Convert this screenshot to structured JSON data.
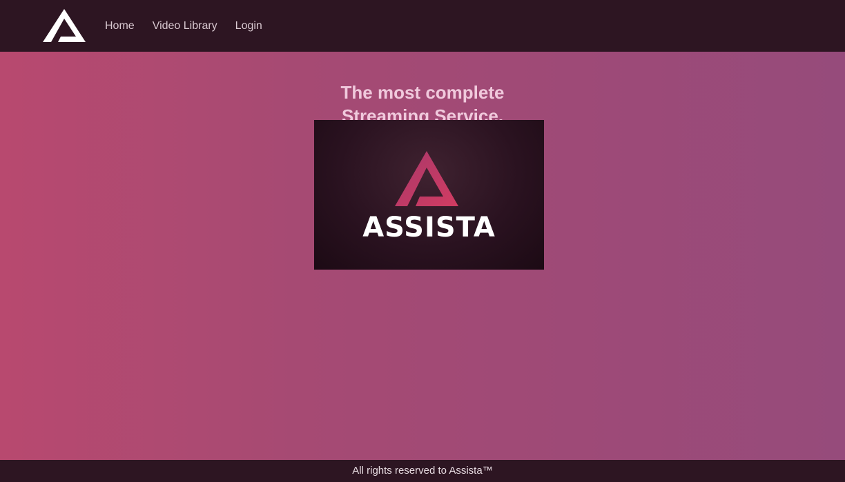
{
  "navbar": {
    "logo_icon": "assista-logo-icon",
    "links": [
      {
        "label": "Home"
      },
      {
        "label": "Video Library"
      },
      {
        "label": "Login"
      }
    ]
  },
  "hero": {
    "title_line1": "The most complete",
    "title_line2": "Streaming Service.",
    "image_brand_text": "ASSISTA",
    "image_logo_icon": "assista-triangle-icon"
  },
  "footer": {
    "text": "All rights reserved to Assista™"
  },
  "colors": {
    "navbar_bg": "#2d1522",
    "page_gradient_start": "#b8496f",
    "page_gradient_end": "#964b7b",
    "hero_title": "#f0c9dc",
    "logo_accent": "#c23a6b"
  }
}
